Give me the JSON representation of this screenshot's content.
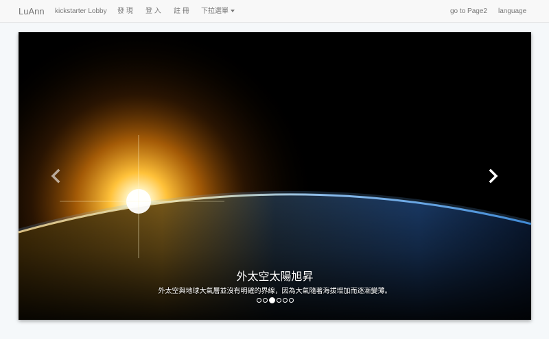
{
  "navbar": {
    "brand": "LuAnn",
    "left_items": [
      {
        "label": "kickstarter Lobby"
      },
      {
        "label": "發 現"
      },
      {
        "label": "登 入"
      },
      {
        "label": "註 冊"
      },
      {
        "label": "下拉選單"
      }
    ],
    "right_items": [
      {
        "label": "go to Page2"
      },
      {
        "label": "language"
      }
    ]
  },
  "carousel": {
    "title": "外太空太陽旭昇",
    "text": "外太空與地球大氣層並沒有明確的界線，因為大氣隨著海拔增加而逐漸變薄。",
    "slide_count": 6,
    "active_index": 2,
    "prev_icon": "chevron-left-icon",
    "next_icon": "chevron-right-icon"
  },
  "colors": {
    "navbar_bg": "#f8f8f8",
    "nav_text": "#777777",
    "page_bg": "#f5f8fa"
  }
}
